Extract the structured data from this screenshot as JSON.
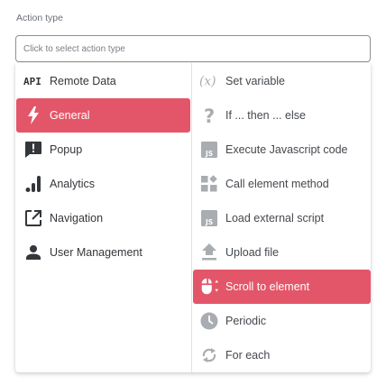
{
  "field": {
    "label": "Action type",
    "placeholder": "Click to select action type"
  },
  "left_items": [
    {
      "label": "Remote Data",
      "icon": "api-icon",
      "icon_text": "API",
      "active": false
    },
    {
      "label": "General",
      "icon": "lightning-icon",
      "active": true
    },
    {
      "label": "Popup",
      "icon": "alert-message-icon",
      "active": false
    },
    {
      "label": "Analytics",
      "icon": "signal-bars-icon",
      "active": false
    },
    {
      "label": "Navigation",
      "icon": "open-in-new-icon",
      "active": false
    },
    {
      "label": "User Management",
      "icon": "user-icon",
      "active": false
    }
  ],
  "right_items": [
    {
      "label": "Set variable",
      "icon": "variable-icon",
      "icon_text": "(x)",
      "active": false
    },
    {
      "label": "If ... then ... else",
      "icon": "question-mark-icon",
      "icon_text": "?",
      "active": false
    },
    {
      "label": "Execute Javascript code",
      "icon": "javascript-icon",
      "icon_text": "JS",
      "active": false
    },
    {
      "label": "Call element method",
      "icon": "widgets-icon",
      "active": false
    },
    {
      "label": "Load external script",
      "icon": "javascript-file-icon",
      "icon_text": "JS",
      "active": false
    },
    {
      "label": "Upload file",
      "icon": "upload-icon",
      "active": false
    },
    {
      "label": "Scroll to element",
      "icon": "mouse-scroll-icon",
      "active": true
    },
    {
      "label": "Periodic",
      "icon": "clock-icon",
      "active": false
    },
    {
      "label": "For each",
      "icon": "loop-icon",
      "active": false
    }
  ],
  "colors": {
    "accent": "#e35669",
    "icon_dark": "#3a3d42",
    "icon_muted": "#a9acb0"
  }
}
